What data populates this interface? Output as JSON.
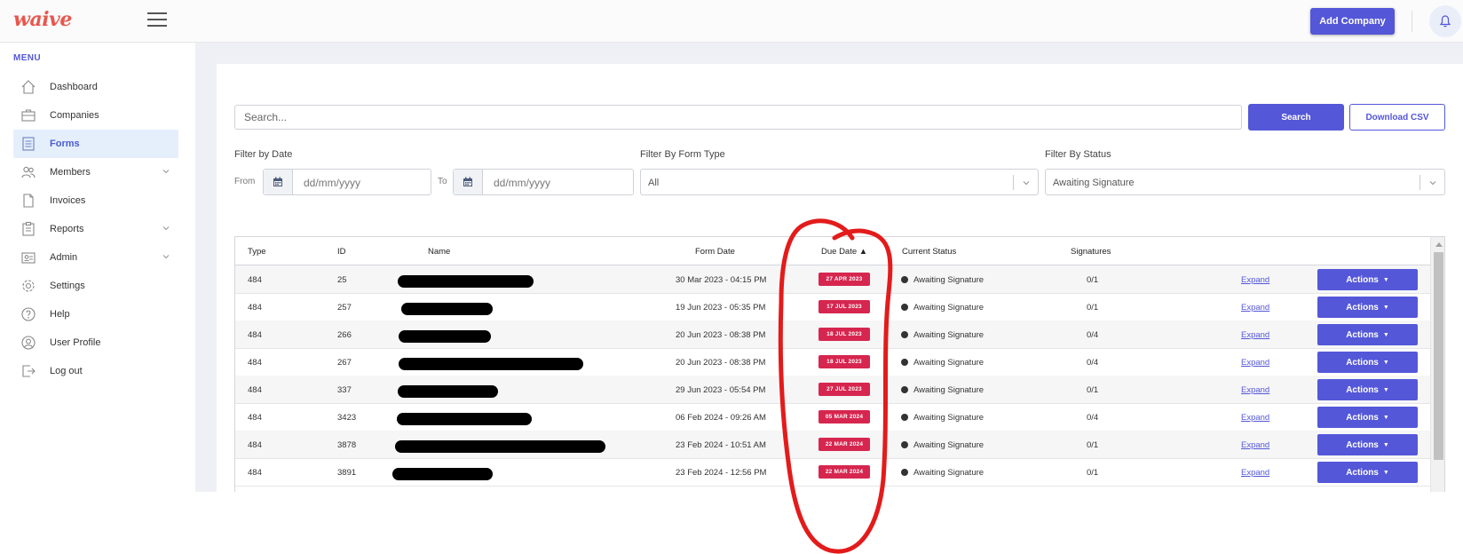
{
  "brand": {
    "logo_text": "waive",
    "logo_color": "#e8574d",
    "accent_color": "#5457d8",
    "badge_color": "#d6264f"
  },
  "header": {
    "add_company_label": "Add Company"
  },
  "sidebar": {
    "menu_title": "MENU",
    "items": [
      {
        "label": "Dashboard",
        "icon": "home-icon"
      },
      {
        "label": "Companies",
        "icon": "briefcase-icon"
      },
      {
        "label": "Forms",
        "icon": "form-icon",
        "active": true
      },
      {
        "label": "Members",
        "icon": "users-icon",
        "has_submenu": true
      },
      {
        "label": "Invoices",
        "icon": "document-icon"
      },
      {
        "label": "Reports",
        "icon": "report-icon",
        "has_submenu": true
      },
      {
        "label": "Admin",
        "icon": "admin-icon",
        "has_submenu": true
      },
      {
        "label": "Settings",
        "icon": "gear-icon"
      },
      {
        "label": "Help",
        "icon": "help-icon"
      },
      {
        "label": "User Profile",
        "icon": "user-icon"
      },
      {
        "label": "Log out",
        "icon": "logout-icon"
      }
    ]
  },
  "search": {
    "placeholder": "Search...",
    "search_label": "Search",
    "csv_label": "Download CSV"
  },
  "filters": {
    "date_label": "Filter by Date",
    "from_label": "From",
    "to_label": "To",
    "date_placeholder": "dd/mm/yyyy",
    "form_type_label": "Filter By Form Type",
    "form_type_value": "All",
    "status_label": "Filter By Status",
    "status_value": "Awaiting Signature"
  },
  "table": {
    "headers": {
      "type": "Type",
      "id": "ID",
      "name": "Name",
      "form_date": "Form Date",
      "due_date": "Due Date",
      "sort_indicator": "▲",
      "current_status": "Current Status",
      "signatures": "Signatures"
    },
    "expand_label": "Expand",
    "actions_label": "Actions",
    "rows": [
      {
        "type": "484",
        "id": "25",
        "form_date": "30 Mar 2023 - 04:15 PM",
        "due_date": "27 APR 2023",
        "status": "Awaiting Signature",
        "signatures": "0/1"
      },
      {
        "type": "484",
        "id": "257",
        "form_date": "19 Jun 2023 - 05:35 PM",
        "due_date": "17 JUL 2023",
        "status": "Awaiting Signature",
        "signatures": "0/1"
      },
      {
        "type": "484",
        "id": "266",
        "form_date": "20 Jun 2023 - 08:38 PM",
        "due_date": "18 JUL 2023",
        "status": "Awaiting Signature",
        "signatures": "0/4"
      },
      {
        "type": "484",
        "id": "267",
        "form_date": "20 Jun 2023 - 08:38 PM",
        "due_date": "18 JUL 2023",
        "status": "Awaiting Signature",
        "signatures": "0/4"
      },
      {
        "type": "484",
        "id": "337",
        "form_date": "29 Jun 2023 - 05:54 PM",
        "due_date": "27 JUL 2023",
        "status": "Awaiting Signature",
        "signatures": "0/1"
      },
      {
        "type": "484",
        "id": "3423",
        "form_date": "06 Feb 2024 - 09:26 AM",
        "due_date": "05 MAR 2024",
        "status": "Awaiting Signature",
        "signatures": "0/4"
      },
      {
        "type": "484",
        "id": "3878",
        "form_date": "23 Feb 2024 - 10:51 AM",
        "due_date": "22 MAR 2024",
        "status": "Awaiting Signature",
        "signatures": "0/1"
      },
      {
        "type": "484",
        "id": "3891",
        "form_date": "23 Feb 2024 - 12:56 PM",
        "due_date": "22 MAR 2024",
        "status": "Awaiting Signature",
        "signatures": "0/1"
      }
    ]
  }
}
